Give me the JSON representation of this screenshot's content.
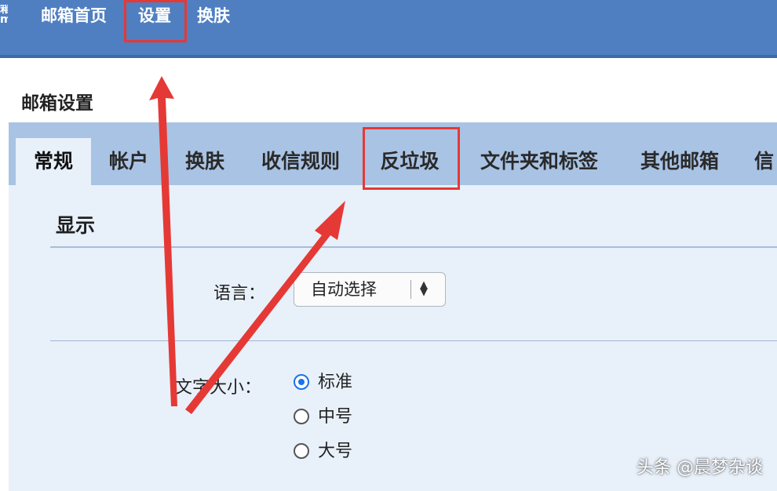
{
  "top_nav": {
    "logo_fragment": "箱\nm",
    "home": "邮箱首页",
    "settings": "设置",
    "skin": "换肤"
  },
  "panel": {
    "title": "邮箱设置"
  },
  "tabs": [
    {
      "label": "常规",
      "active": true
    },
    {
      "label": "帐户",
      "active": false
    },
    {
      "label": "换肤",
      "active": false
    },
    {
      "label": "收信规则",
      "active": false
    },
    {
      "label": "反垃圾",
      "active": false
    },
    {
      "label": "文件夹和标签",
      "active": false
    },
    {
      "label": "其他邮箱",
      "active": false
    },
    {
      "label": "信",
      "active": false
    }
  ],
  "display": {
    "section_title": "显示",
    "language_label": "语言：",
    "language_value": "自动选择",
    "font_size_label": "文字大小：",
    "font_size_options": [
      {
        "label": "标准",
        "checked": true
      },
      {
        "label": "中号",
        "checked": false
      },
      {
        "label": "大号",
        "checked": false
      }
    ]
  },
  "annotations": {
    "highlight_color": "#e53935",
    "arrow_color": "#e53935",
    "highlighted_items": [
      "设置",
      "反垃圾"
    ]
  },
  "watermark": "头条 @晨梦杂谈",
  "colors": {
    "topbar": "#4f7fc0",
    "tabbar": "#a9c3e4",
    "content_bg": "#e8f0fa",
    "radio_checked": "#1a73e8"
  }
}
